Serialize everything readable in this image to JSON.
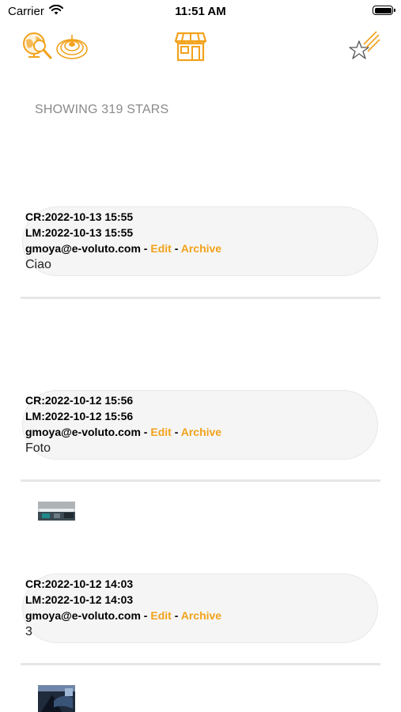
{
  "status_bar": {
    "carrier": "Carrier",
    "time": "11:51 AM"
  },
  "toolbar": {
    "icons": [
      "globe-search-icon",
      "signal-rings-icon",
      "store-icon",
      "shooting-star-icon"
    ],
    "accent_color": "#F2A21C"
  },
  "header": {
    "showing": "SHOWING 319 STARS"
  },
  "posts": [
    {
      "created": "CR:2022-10-13 15:55",
      "modified": "LM:2022-10-13 15:55",
      "author": "gmoya@e-voluto.com",
      "sep1": " - ",
      "edit": "Edit",
      "sep2": " - ",
      "archive": "Archive",
      "message": "Ciao"
    },
    {
      "created": "CR:2022-10-12 15:56",
      "modified": "LM:2022-10-12 15:56",
      "author": "gmoya@e-voluto.com",
      "sep1": " - ",
      "edit": "Edit",
      "sep2": " - ",
      "archive": "Archive",
      "message": "Foto"
    },
    {
      "created": "CR:2022-10-12 14:03",
      "modified": "LM:2022-10-12 14:03",
      "author": "gmoya@e-voluto.com",
      "sep1": " - ",
      "edit": "Edit",
      "sep2": " - ",
      "archive": "Archive",
      "message": "3"
    }
  ]
}
